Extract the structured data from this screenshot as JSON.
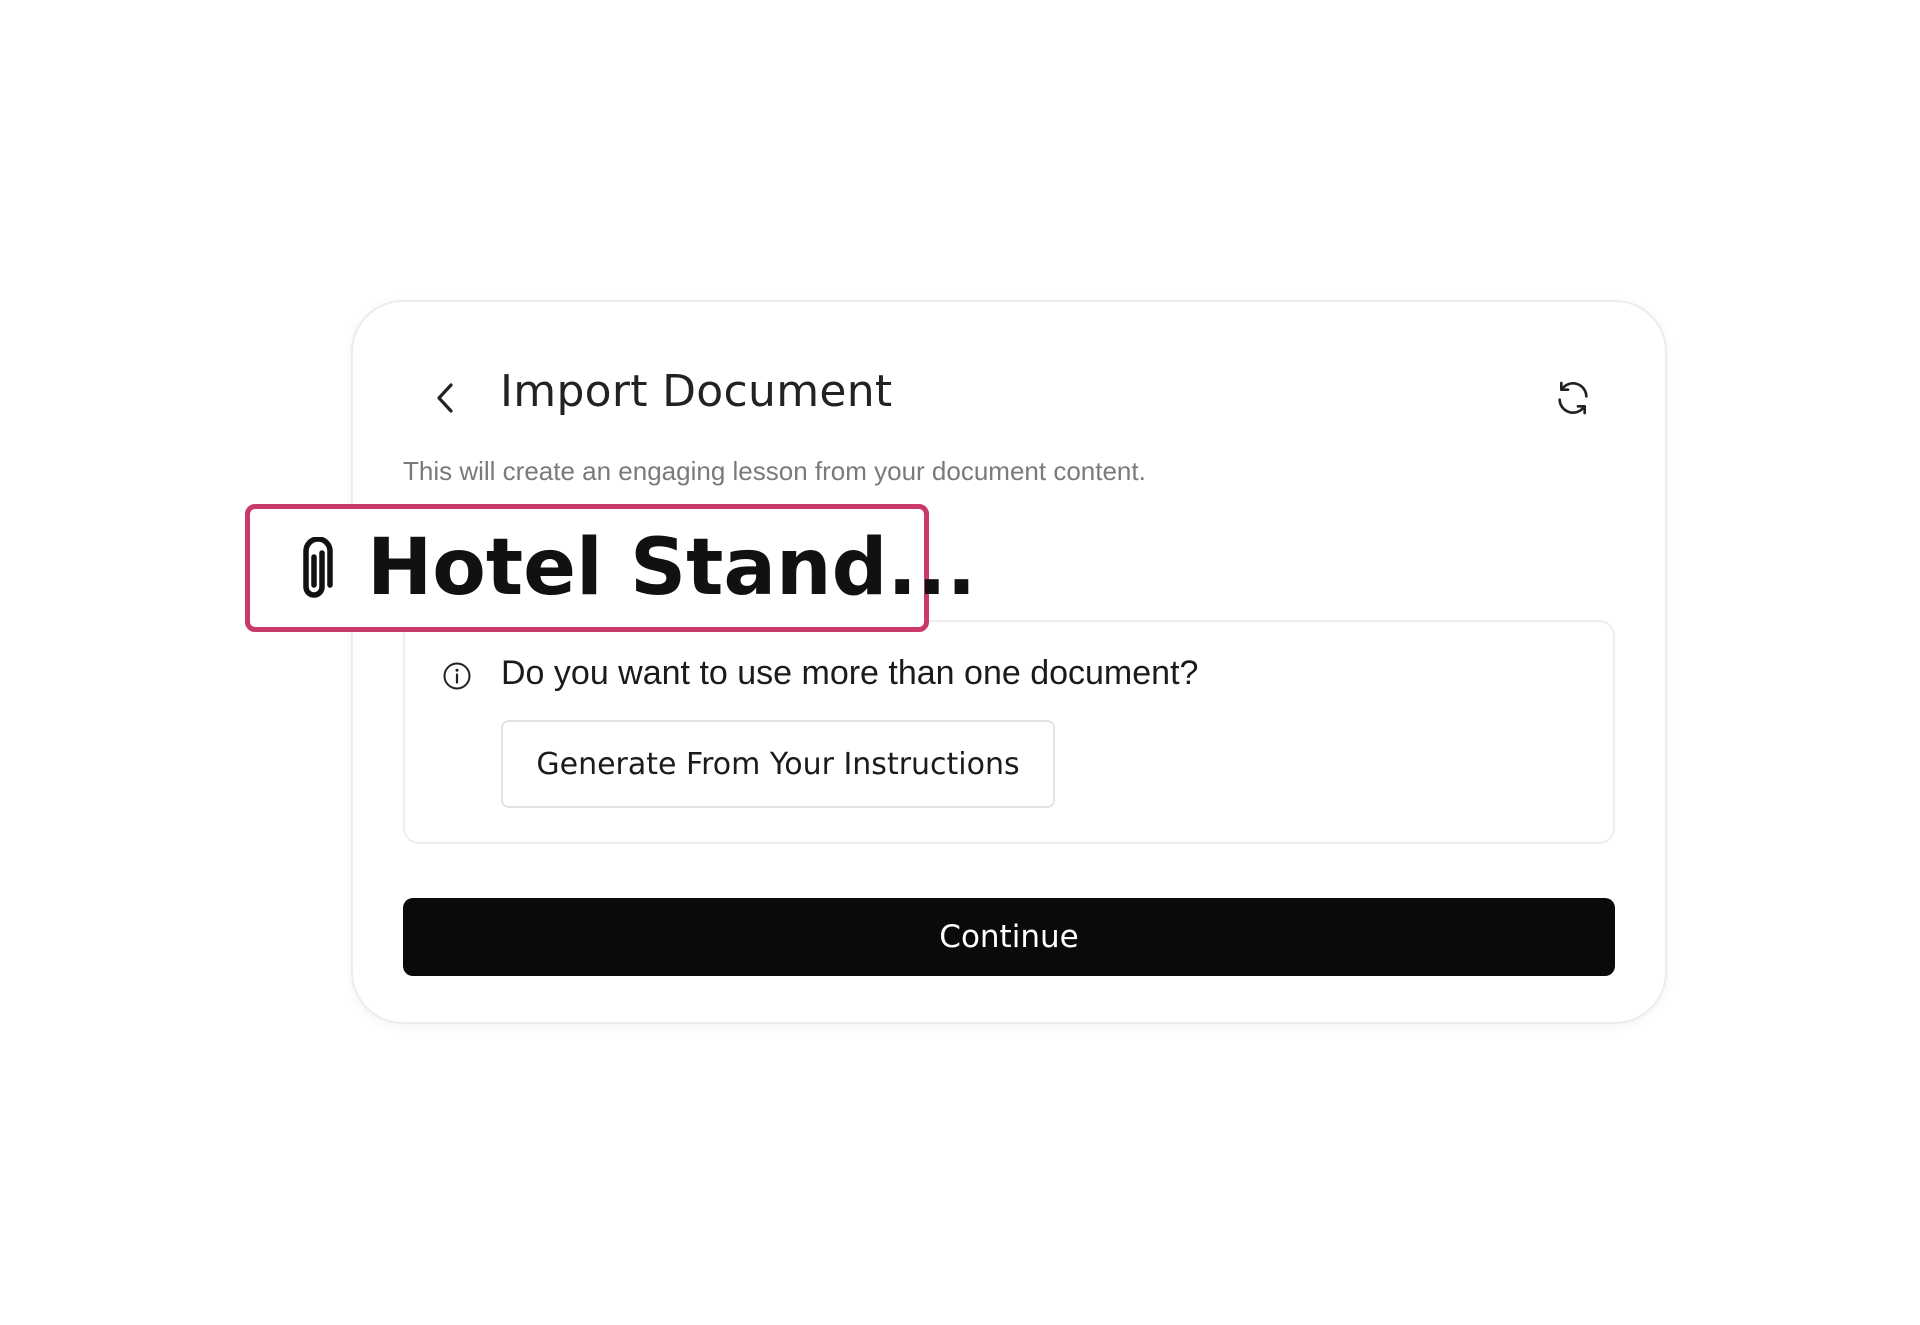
{
  "dialog": {
    "title": "Import Document",
    "subtitle": "This will create an engaging lesson from your document content.",
    "back_icon": "chevron-left-icon",
    "refresh_icon": "refresh-icon"
  },
  "attached_document": {
    "icon": "paperclip-icon",
    "name": "Hotel Stand...",
    "highlight_color": "#c83a6c"
  },
  "info_box": {
    "icon": "info-icon",
    "question": "Do you want to use more than one document?",
    "button_label": "Generate From Your Instructions"
  },
  "actions": {
    "continue_label": "Continue"
  }
}
